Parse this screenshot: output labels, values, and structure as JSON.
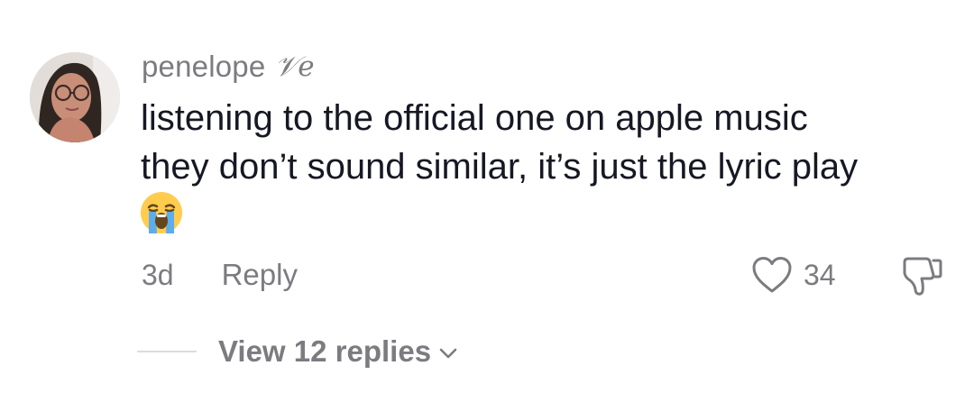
{
  "comment": {
    "username": "penelope",
    "username_suffix": "𝒱e",
    "text_lines": [
      "listening to the official one on apple music",
      "they don’t sound similar, it’s just the lyric play"
    ],
    "emoji": "loudly-crying-face",
    "timestamp": "3d",
    "reply_label": "Reply",
    "like_count": "34",
    "view_replies_label": "View 12 replies",
    "icons": {
      "like": "heart-icon",
      "dislike": "thumbs-down-icon",
      "expand": "chevron-down-icon"
    },
    "colors": {
      "text_primary": "#161823",
      "text_secondary": "#7b7b80",
      "divider": "#dcdcde"
    }
  }
}
